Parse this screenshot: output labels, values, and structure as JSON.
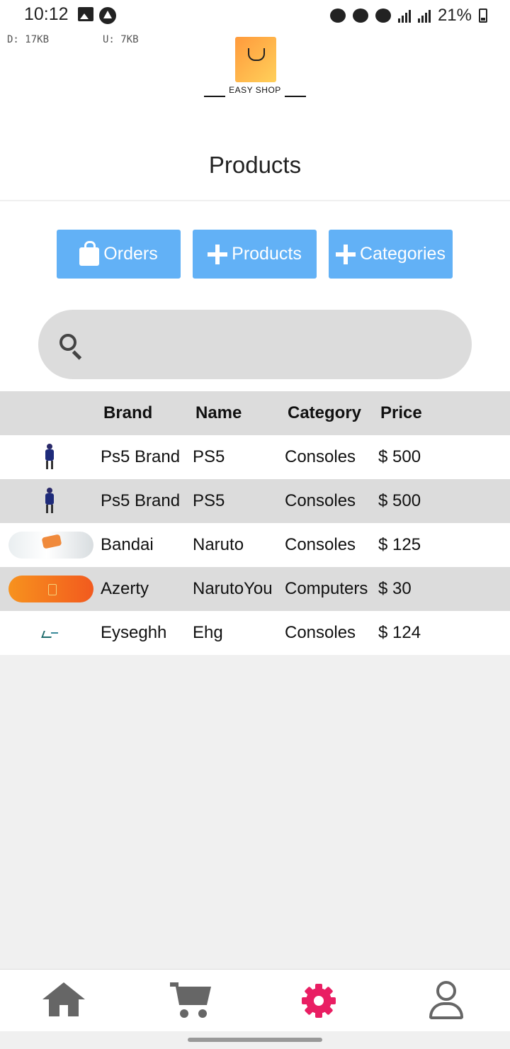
{
  "status_bar": {
    "time": "10:12",
    "battery": "21%",
    "download": "D: 17KB",
    "upload": "U: 7KB"
  },
  "header": {
    "logo_text": "EASY SHOP",
    "title": "Products"
  },
  "actions": {
    "orders_label": "Orders",
    "products_label": "Products",
    "categories_label": "Categories",
    "button_color": "#62b1f6"
  },
  "search": {
    "value": "",
    "placeholder": ""
  },
  "table": {
    "headers": {
      "brand": "Brand",
      "name": "Name",
      "category": "Category",
      "price": "Price"
    },
    "rows": [
      {
        "image": "player-figure",
        "brand": "Ps5 Brand",
        "name": "PS5",
        "category": "Consoles",
        "price": "$ 500"
      },
      {
        "image": "player-figure",
        "brand": "Ps5 Brand",
        "name": "PS5",
        "category": "Consoles",
        "price": "$ 500"
      },
      {
        "image": "banner-photo",
        "brand": "Bandai",
        "name": "Naruto",
        "category": "Consoles",
        "price": "$ 125"
      },
      {
        "image": "orange-banner",
        "brand": "Azerty",
        "name": "NarutoYou",
        "category": "Computers",
        "price": "$ 30"
      },
      {
        "image": "sketch",
        "brand": "Eyseghh",
        "name": "Ehg",
        "category": "Consoles",
        "price": "$ 124"
      }
    ]
  },
  "bottom_nav": {
    "items": [
      "home-icon",
      "cart-icon",
      "settings-icon",
      "user-icon"
    ],
    "active": "settings-icon",
    "active_color": "#e91e63",
    "inactive_color": "#666666"
  }
}
